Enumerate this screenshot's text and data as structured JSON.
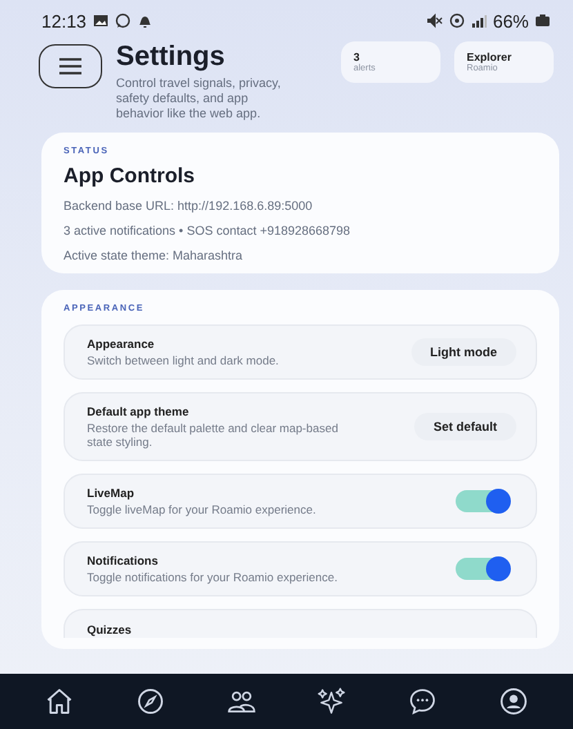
{
  "status_bar": {
    "time": "12:13",
    "battery": "66%"
  },
  "header": {
    "title": "Settings",
    "subtitle": "Control travel signals, privacy, safety defaults, and app behavior like the web app.",
    "chips": [
      {
        "value": "3",
        "label": "alerts"
      },
      {
        "value": "Explorer",
        "label": "Roamio"
      }
    ]
  },
  "status_card": {
    "eyebrow": "STATUS",
    "title": "App Controls",
    "lines": [
      "Backend base URL: http://192.168.6.89:5000",
      "3 active notifications • SOS contact +918928668798",
      "Active state theme: Maharashtra"
    ]
  },
  "appearance_card": {
    "eyebrow": "APPEARANCE",
    "rows": [
      {
        "kind": "button",
        "title": "Appearance",
        "description": "Switch between light and dark mode.",
        "action": "Light mode"
      },
      {
        "kind": "button",
        "title": "Default app theme",
        "description": "Restore the default palette and clear map-based state styling.",
        "action": "Set default"
      },
      {
        "kind": "toggle",
        "title": "LiveMap",
        "description": "Toggle liveMap for your Roamio experience.",
        "on": true
      },
      {
        "kind": "toggle",
        "title": "Notifications",
        "description": "Toggle notifications for your Roamio experience.",
        "on": true
      },
      {
        "kind": "partial",
        "title": "Quizzes"
      }
    ]
  }
}
